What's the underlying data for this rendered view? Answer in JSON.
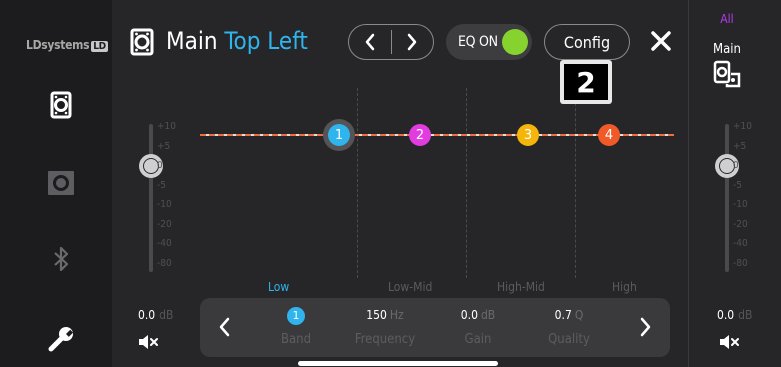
{
  "brand": {
    "name": "LDsystems",
    "mark": "LD"
  },
  "header": {
    "title_main": "Main",
    "title_sub": "Top Left",
    "eq_label": "EQ ON",
    "config_label": "Config",
    "badge": "2"
  },
  "sidebar": {
    "items": [
      {
        "icon": "speaker-icon",
        "active": true
      },
      {
        "icon": "subwoofer-icon",
        "active": false
      },
      {
        "icon": "bluetooth-icon",
        "active": false
      },
      {
        "icon": "wrench-icon",
        "active": false
      }
    ]
  },
  "fader_scale": [
    "+10",
    "+5",
    "0",
    "-5",
    "-10",
    "-20",
    "-40",
    "-80"
  ],
  "left_fader": {
    "value": "0.0",
    "unit": "dB"
  },
  "bands": [
    {
      "number": "1",
      "label": "Low",
      "color": "#2fb4ee",
      "selected": true
    },
    {
      "number": "2",
      "label": "Low-Mid",
      "color": "#e23bdf",
      "selected": false
    },
    {
      "number": "3",
      "label": "High-Mid",
      "color": "#f5b50a",
      "selected": false
    },
    {
      "number": "4",
      "label": "High",
      "color": "#f05a28",
      "selected": false
    }
  ],
  "params": {
    "band": {
      "value": "1",
      "label": "Band"
    },
    "frequency": {
      "value": "150",
      "unit": "Hz",
      "label": "Frequency"
    },
    "gain": {
      "value": "0.0",
      "unit": "dB",
      "label": "Gain"
    },
    "quality": {
      "value": "0.7",
      "unit": "Q",
      "label": "Quality"
    }
  },
  "right_panel": {
    "all_label": "All",
    "channel_label": "Main",
    "fader": {
      "value": "0.0",
      "unit": "dB"
    }
  },
  "colors": {
    "accent": "#2fb4ee",
    "eq_on": "#86d22f",
    "all": "#b93bf0"
  }
}
